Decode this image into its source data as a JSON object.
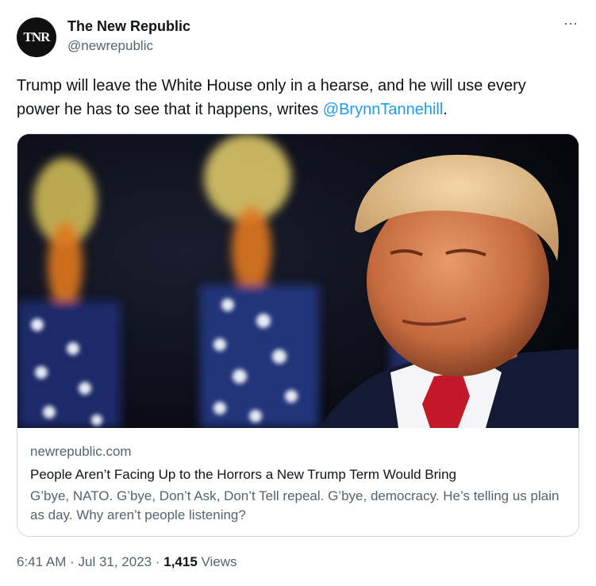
{
  "account": {
    "avatar_text": "TNR",
    "display_name": "The New Republic",
    "handle": "@newrepublic",
    "more_icon": "⋯"
  },
  "tweet": {
    "text_before": "Trump will leave the White House only in a hearse, and he will use every power he has to see that it happens, writes ",
    "mention": "@BrynnTannehill",
    "text_after": "."
  },
  "card": {
    "image_description_icon": "photo",
    "domain": "newrepublic.com",
    "title": "People Aren’t Facing Up to the Horrors a New Trump Term Would Bring",
    "description": "G’bye, NATO. G’bye, Don’t Ask, Don’t Tell repeal. G’bye, democracy. He’s telling us plain as day. Why aren’t people listening?"
  },
  "meta": {
    "time": "6:41 AM",
    "sep1": " · ",
    "date": "Jul 31, 2023",
    "sep2": " · ",
    "views_count": "1,415",
    "views_label": " Views"
  },
  "colors": {
    "accent": "#1d9bf0",
    "text": "#0f1419",
    "muted": "#536471",
    "border": "#cfd9de"
  }
}
